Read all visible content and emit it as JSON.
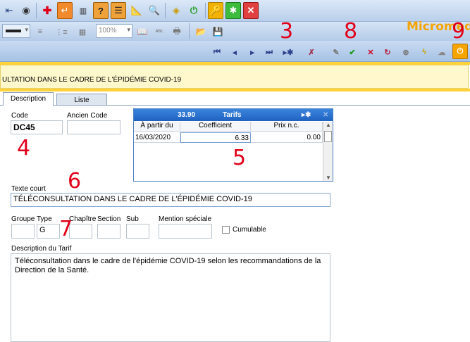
{
  "toolbar_top": {
    "icons": [
      "back-icon",
      "eye-icon",
      "red-cross-icon",
      "return-icon",
      "barcode-icon",
      "question-icon",
      "list-icon",
      "ruler-icon",
      "search-icon",
      "warning-icon",
      "power-icon",
      "key-icon",
      "star-icon",
      "close-icon"
    ]
  },
  "toolbar_format": {
    "zoom": "100%"
  },
  "app_title": "Micromed",
  "annotations": {
    "a3": "3",
    "a8": "8",
    "a9": "9",
    "a4": "4",
    "a5": "5",
    "a6": "6",
    "a7": "7"
  },
  "record_title": "ULTATION DANS LE CADRE DE L'ÉPIDÉMIE COVID-19",
  "tabs": {
    "description": "Description",
    "liste": "Liste"
  },
  "form": {
    "code_label": "Code",
    "code_value": "DC45",
    "ancien_code_label": "Ancien Code",
    "ancien_code_value": "",
    "texte_court_label": "Texte court",
    "texte_court_value": "TÉLÉCONSULTATION DANS LE CADRE DE L'ÉPIDÉMIE COVID-19",
    "groupe_label": "Groupe",
    "type_label": "Type",
    "type_value": "G",
    "chapitre_label": "Chapître",
    "section_label": "Section",
    "sub_label": "Sub",
    "mention_label": "Mention spéciale",
    "cumulable_label": "Cumulable",
    "description_label": "Description du Tarif",
    "description_value": "Téléconsultation dans le cadre de l'épidémie COVID-19 selon les recommandations de la Direction de la Santé."
  },
  "tarifs": {
    "amount": "33.90",
    "title": "Tarifs",
    "columns": [
      "À partir du",
      "Coefficient",
      "Prix n.c."
    ],
    "rows": [
      {
        "date": "16/03/2020",
        "coefficient": "6.33",
        "prix": "0.00"
      }
    ]
  },
  "colors": {
    "accent": "#f5a400",
    "annotation": "#e1001a",
    "grid_header": "#1f62c0"
  }
}
